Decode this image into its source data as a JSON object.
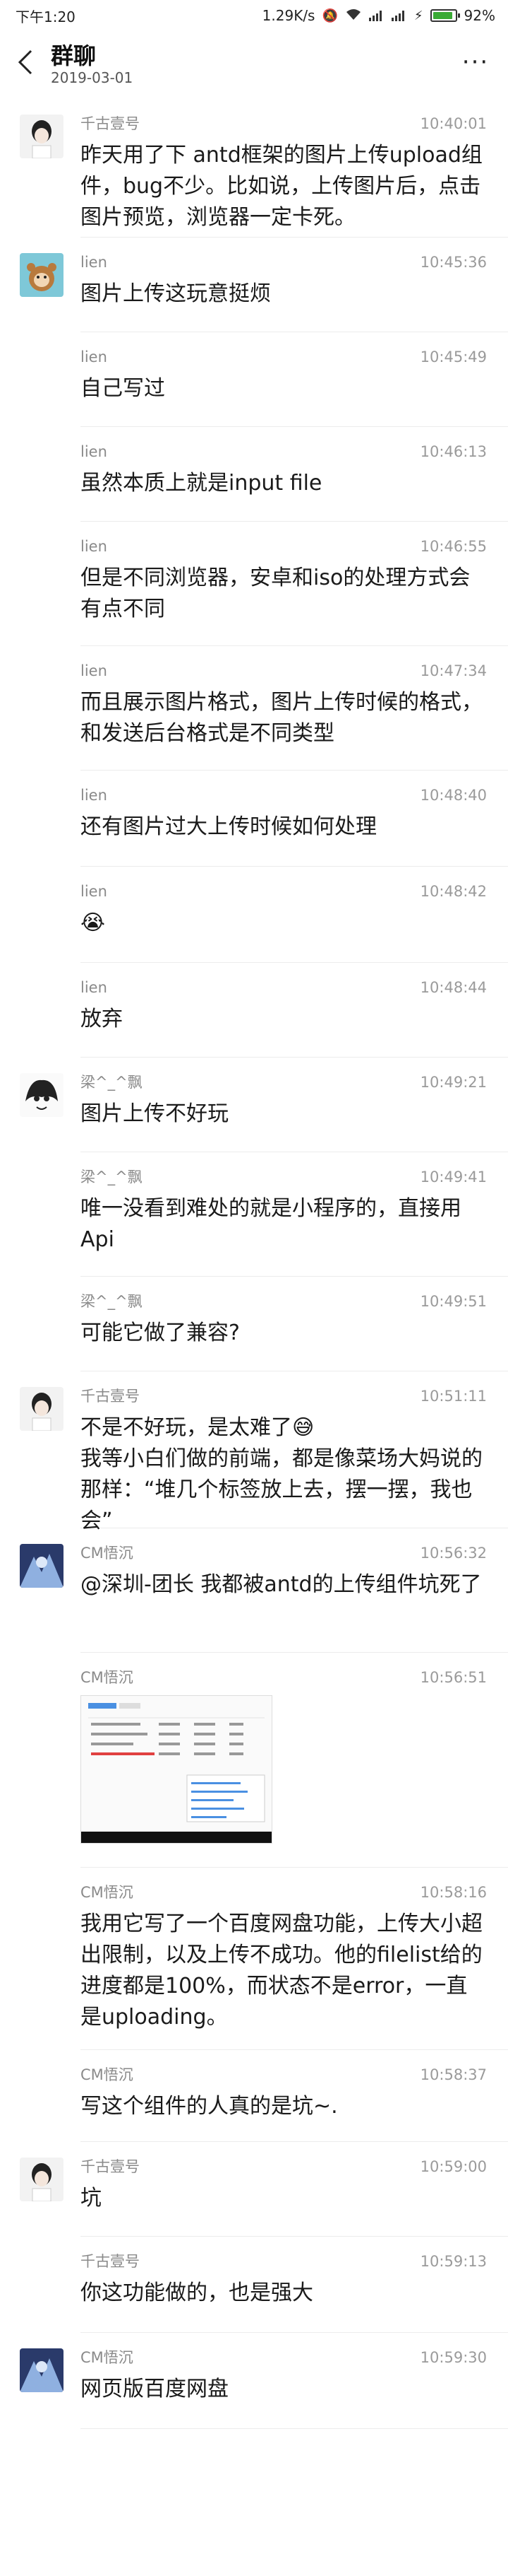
{
  "status": {
    "time": "下午1:20",
    "speed": "1.29K/s",
    "battery": "92%",
    "battery_level": 0.92
  },
  "header": {
    "title": "群聊",
    "date": "2019-03-01",
    "back_icon": "chevron-left-icon",
    "more_icon": "more-dots-icon",
    "more_label": "···"
  },
  "messages": [
    {
      "sender": "千古壹号",
      "time": "10:40:01",
      "text": "昨天用了下 antd框架的图片上传upload组件，bug不少。比如说，上传图片后，点击图片预览，浏览器一定卡死。"
    },
    {
      "sender": "lien",
      "time": "10:45:36",
      "text": "图片上传这玩意挺烦"
    },
    {
      "sender": "lien",
      "time": "10:45:49",
      "text": "自己写过"
    },
    {
      "sender": "lien",
      "time": "10:46:13",
      "text": "虽然本质上就是input file"
    },
    {
      "sender": "lien",
      "time": "10:46:55",
      "text": "但是不同浏览器，安卓和iso的处理方式会有点不同"
    },
    {
      "sender": "lien",
      "time": "10:47:34",
      "text": "而且展示图片格式，图片上传时候的格式，和发送后台格式是不同类型"
    },
    {
      "sender": "lien",
      "time": "10:48:40",
      "text": "还有图片过大上传时候如何处理"
    },
    {
      "sender": "lien",
      "time": "10:48:42",
      "text": "😭"
    },
    {
      "sender": "lien",
      "time": "10:48:44",
      "text": "放弃"
    },
    {
      "sender": "梁^_^飘",
      "time": "10:49:21",
      "text": "图片上传不好玩"
    },
    {
      "sender": "梁^_^飘",
      "time": "10:49:41",
      "text": "唯一没看到难处的就是小程序的，直接用Api"
    },
    {
      "sender": "梁^_^飘",
      "time": "10:49:51",
      "text": "可能它做了兼容?"
    },
    {
      "sender": "千古壹号",
      "time": "10:51:11",
      "text": "不是不好玩，是太难了😅\n我等小白们做的前端，都是像菜场大妈说的那样：“堆几个标签放上去，摆一摆，我也会”"
    },
    {
      "sender": "CM悟沉",
      "time": "10:56:32",
      "text": "@深圳-团长 我都被antd的上传组件坑死了"
    },
    {
      "sender": "CM悟沉",
      "time": "10:56:51",
      "text": ""
    },
    {
      "sender": "CM悟沉",
      "time": "10:58:16",
      "text": "我用它写了一个百度网盘功能，上传大小超出限制，以及上传不成功。他的filelist给的进度都是100%，而状态不是error，一直是uploading。"
    },
    {
      "sender": "CM悟沉",
      "time": "10:58:37",
      "text": "写这个组件的人真的是坑~."
    },
    {
      "sender": "千古壹号",
      "time": "10:59:00",
      "text": "坑"
    },
    {
      "sender": "千古壹号",
      "time": "10:59:13",
      "text": "你这功能做的，也是强大"
    },
    {
      "sender": "CM悟沉",
      "time": "10:59:30",
      "text": "网页版百度网盘"
    }
  ]
}
